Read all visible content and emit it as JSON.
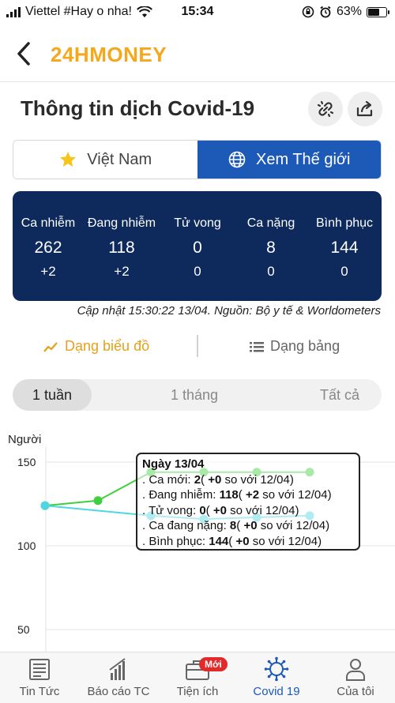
{
  "status_bar": {
    "carrier": "Viettel #Hay o nha!",
    "time": "15:34",
    "battery_percent_label": "63%",
    "battery_level": 0.63
  },
  "header": {
    "logo": "24HMONEY",
    "back_icon": "chevron-left-icon"
  },
  "page": {
    "title": "Thông tin dịch Covid-19",
    "actions": [
      "link-icon",
      "share-icon"
    ]
  },
  "region_toggle": {
    "vietnam_label": "Việt Nam",
    "world_label": "Xem Thế giới",
    "active": "world"
  },
  "stats": {
    "columns": [
      {
        "label": "Ca nhiễm",
        "value": "262",
        "delta": "+2"
      },
      {
        "label": "Đang nhiễm",
        "value": "118",
        "delta": "+2"
      },
      {
        "label": "Tử vong",
        "value": "0",
        "delta": "0"
      },
      {
        "label": "Ca nặng",
        "value": "8",
        "delta": "0"
      },
      {
        "label": "Bình phục",
        "value": "144",
        "delta": "0"
      }
    ],
    "update_note": "Cập nhật 15:30:22 13/04. Nguồn: Bộ y tế & Worldometers"
  },
  "view_tabs": {
    "chart_label": "Dạng biểu đồ",
    "table_label": "Dạng bảng",
    "active": "chart"
  },
  "period": {
    "options": [
      "1 tuần",
      "1 tháng",
      "Tất cả"
    ],
    "active": "1 tuần"
  },
  "chart_data": {
    "type": "line",
    "ylabel": "Người",
    "y_ticks": [
      150,
      100,
      50
    ],
    "ylim": [
      30,
      160
    ],
    "grid": "horizontal",
    "series": [
      {
        "color": "#3fcf3f",
        "points": [
          [
            0,
            124
          ],
          [
            1,
            127
          ],
          [
            2,
            144
          ],
          [
            3,
            144
          ],
          [
            4,
            144
          ],
          [
            5,
            144
          ]
        ]
      },
      {
        "color": "#4fd6e0",
        "points": [
          [
            0,
            124
          ],
          [
            2,
            118
          ],
          [
            3,
            116
          ],
          [
            4,
            117
          ],
          [
            5,
            118
          ]
        ]
      }
    ],
    "tooltip": {
      "title": "Ngày 13/04",
      "lines": [
        {
          "prefix": ". Ca mới: ",
          "value": "2",
          "mid": "( ",
          "delta": "+0",
          "suffix": " so với 12/04)"
        },
        {
          "prefix": ". Đang nhiễm: ",
          "value": "118",
          "mid": "( ",
          "delta": "+2",
          "suffix": " so với 12/04)"
        },
        {
          "prefix": ". Tử vong: ",
          "value": "0",
          "mid": "( ",
          "delta": "+0",
          "suffix": " so với 12/04)"
        },
        {
          "prefix": ". Ca đang nặng: ",
          "value": "8",
          "mid": "( ",
          "delta": "+0",
          "suffix": " so với 12/04)"
        },
        {
          "prefix": ". Bình phục: ",
          "value": "144",
          "mid": "( ",
          "delta": "+0",
          "suffix": " so với 12/04)"
        }
      ]
    }
  },
  "bottom_nav": {
    "items": [
      {
        "label": "Tin Tức",
        "icon": "newspaper-icon"
      },
      {
        "label": "Báo cáo TC",
        "icon": "bar-chart-icon"
      },
      {
        "label": "Tiện ích",
        "icon": "briefcase-icon",
        "badge": "Mới"
      },
      {
        "label": "Covid 19",
        "icon": "virus-icon"
      },
      {
        "label": "Của tôi",
        "icon": "user-icon"
      }
    ],
    "active": "Covid 19"
  }
}
